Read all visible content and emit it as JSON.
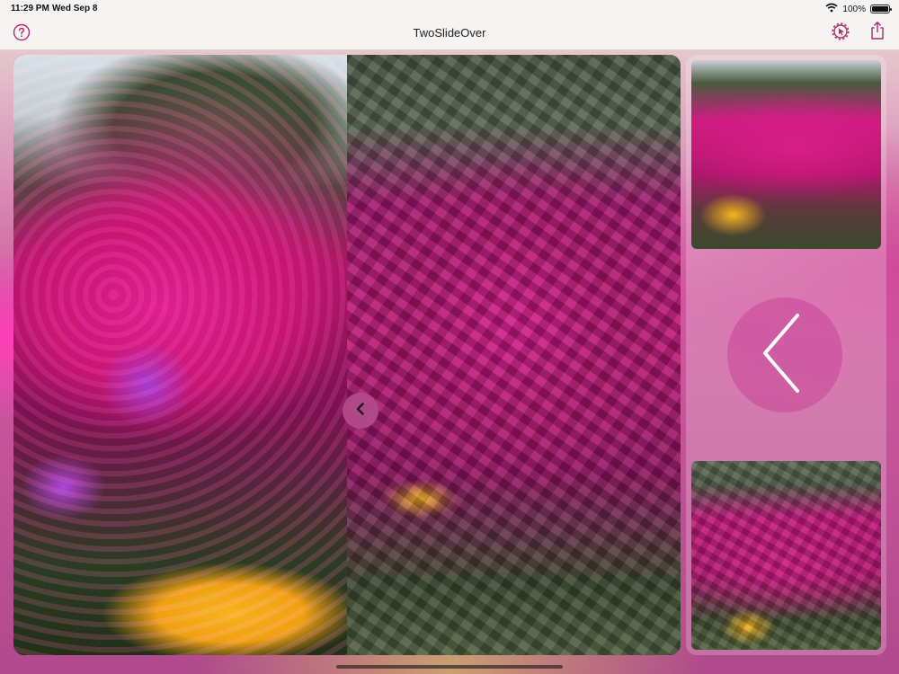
{
  "status_bar": {
    "time": "11:29 PM",
    "date": "Wed Sep 8",
    "battery": "100%",
    "battery_level": 1.0
  },
  "nav": {
    "title": "TwoSlideOver"
  },
  "icons": {
    "help": "help-circle-icon",
    "settings": "gear-cursor-icon",
    "share": "share-icon",
    "wifi": "wifi-icon",
    "battery": "battery-icon",
    "chevron_left_small": "chevron-left-icon",
    "chevron_left_large": "chevron-left-icon"
  },
  "colors": {
    "accent": "#b02a6a",
    "nav_background": "#f6f3f3",
    "handle": "#b24a8a"
  }
}
